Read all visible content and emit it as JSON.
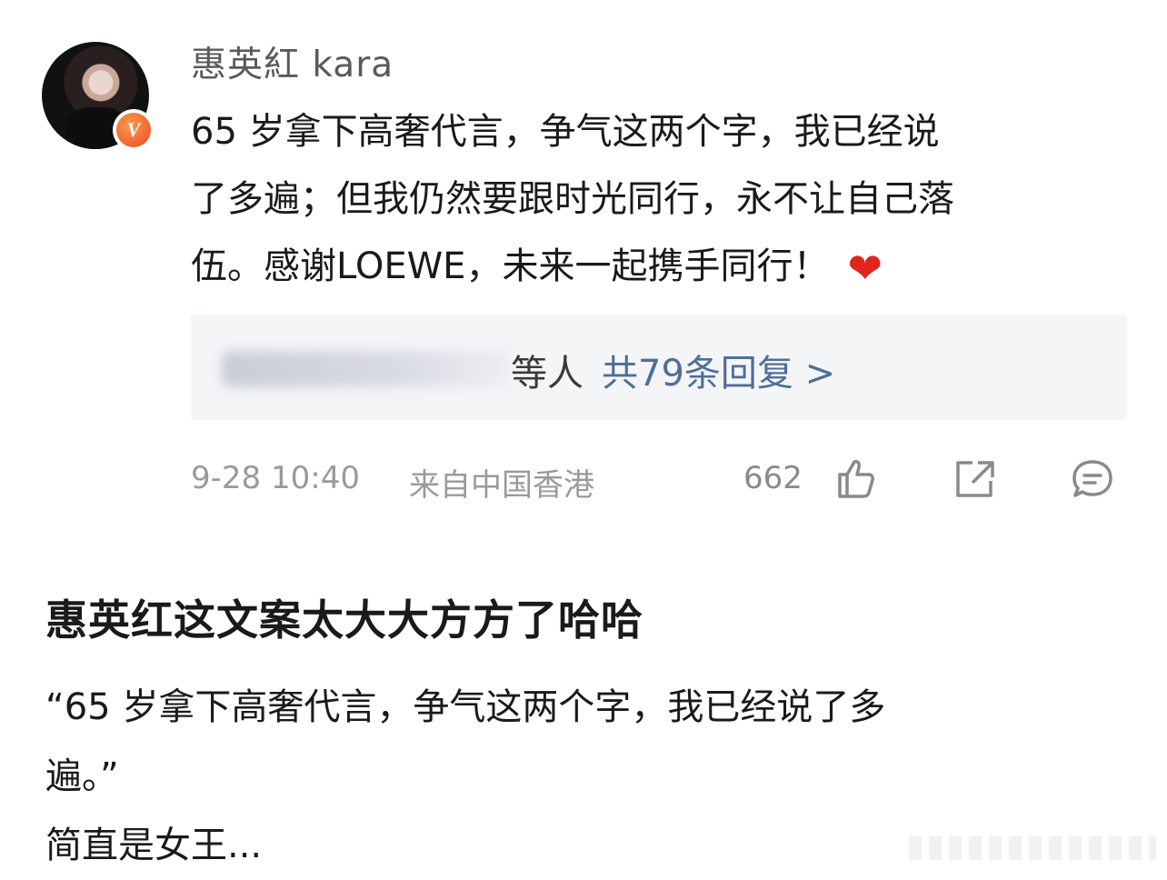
{
  "post": {
    "username": "惠英紅 kara",
    "verified_badge": "V",
    "text_line1": "65 岁拿下高奢代言，争气这两个字，我已经说",
    "text_line2": "了多遍；但我仍然要跟时光同行，永不让自己落",
    "text_line3": "伍。感谢LOEWE，未来一起携手同行！",
    "emoji": "❤",
    "replies": {
      "people_suffix": "等人",
      "count_link": "共79条回复 >"
    },
    "meta": {
      "time": "9-28 10:40",
      "location": "来自中国香港",
      "likes": "662"
    }
  },
  "commentary": {
    "headline": "惠英红这文案太大大方方了哈哈",
    "line1": "“65 岁拿下高奢代言，争气这两个字，我已经说了多",
    "line2": "遍。”",
    "line3": "简直是女王..."
  },
  "colors": {
    "link": "#4f6e97",
    "heart": "#e0261b",
    "badge": "#e8492a",
    "meta": "#9a9a9a"
  },
  "icons": [
    "like-icon",
    "share-icon",
    "comment-icon",
    "verified-badge-icon",
    "heart-icon"
  ]
}
